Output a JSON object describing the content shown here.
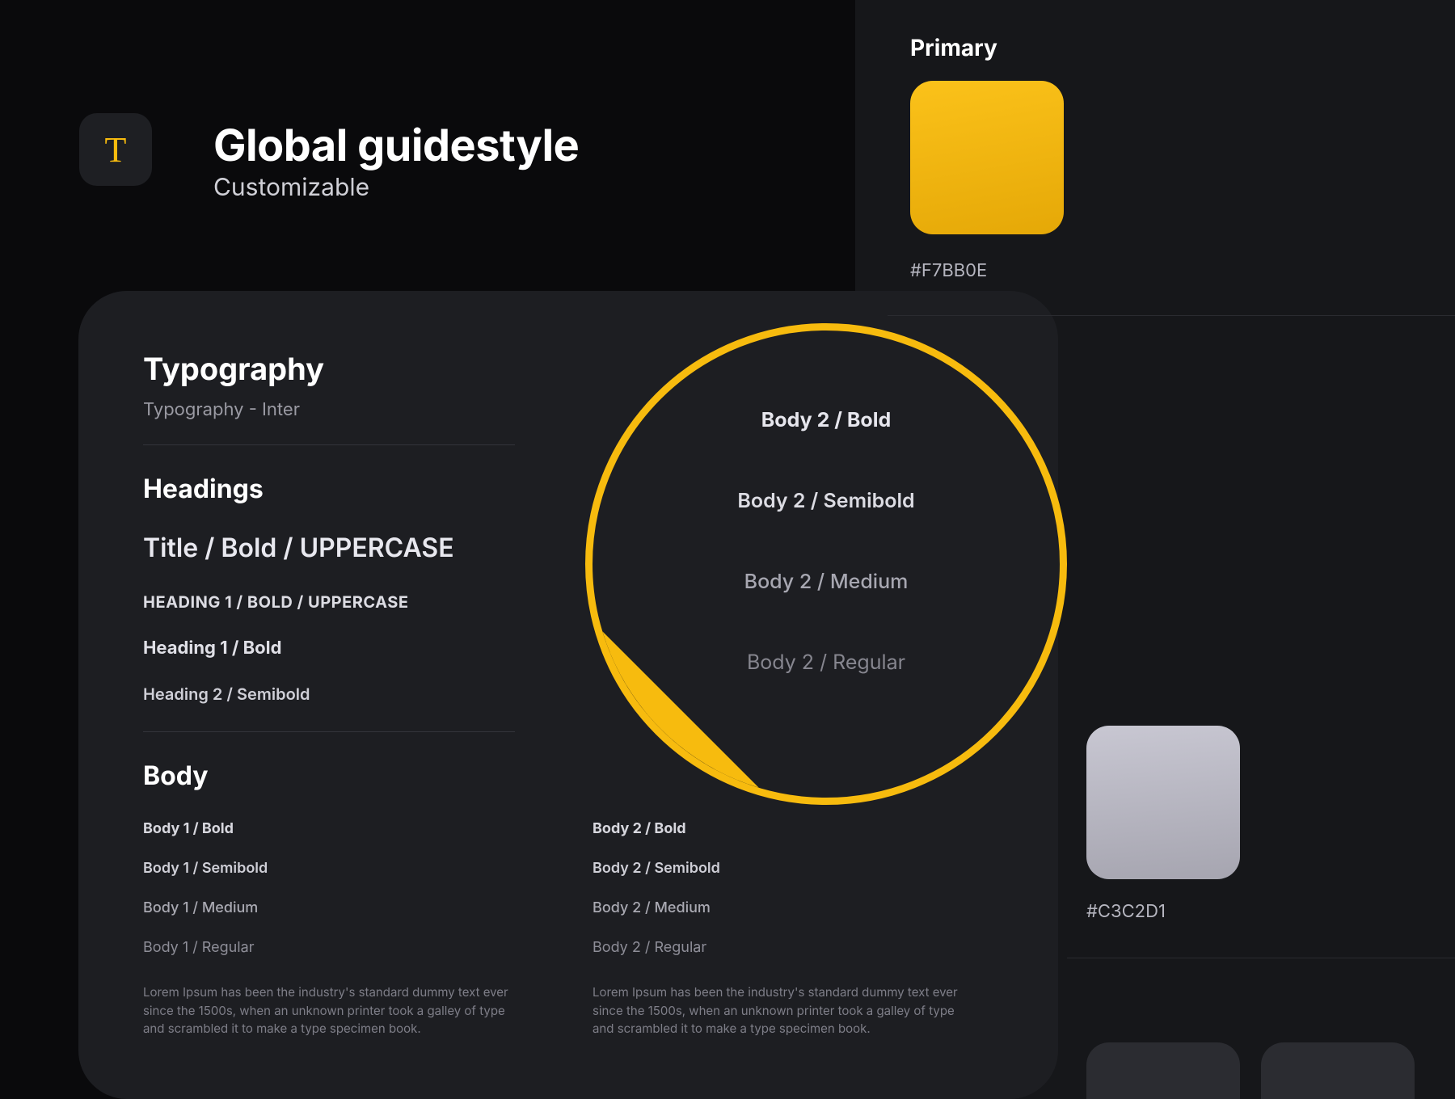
{
  "header": {
    "icon_glyph": "T",
    "title": "Global guidestyle",
    "subtitle": "Customizable"
  },
  "typography": {
    "section_title": "Typography",
    "section_sub": "Typography - Inter",
    "headings_title": "Headings",
    "heading_samples": {
      "title": "Title / Bold / UPPERCASE",
      "h1_upper": "HEADING 1 / BOLD / UPPERCASE",
      "h1_bold": "Heading 1 / Bold",
      "h2_semi": "Heading 2 / Semibold"
    },
    "body_title": "Body",
    "body_cols": [
      {
        "bold": "Body 1 / Bold",
        "semi": "Body 1 / Semibold",
        "med": "Body 1 / Medium",
        "reg": "Body 1 / Regular",
        "lorem": "Lorem Ipsum has been the industry's standard dummy text ever since the 1500s, when an unknown printer took a galley of  type and scrambled it to make a type specimen book."
      },
      {
        "bold": "Body 2 / Bold",
        "semi": "Body 2 / Semibold",
        "med": "Body 2 / Medium",
        "reg": "Body 2 / Regular",
        "lorem": "Lorem Ipsum has been the industry's standard dummy text ever since the 1500s, when an unknown printer took a galley of  type and scrambled it to make a type specimen book."
      }
    ]
  },
  "magnifier": {
    "lines": [
      "Body 2 / Bold",
      "Body 2 / Semibold",
      "Body 2 / Medium",
      "Body 2 / Regular"
    ]
  },
  "colors": {
    "primary_title": "Primary",
    "primary_hex": "#F7BB0E",
    "grey_hex": "#C3C2D1"
  }
}
